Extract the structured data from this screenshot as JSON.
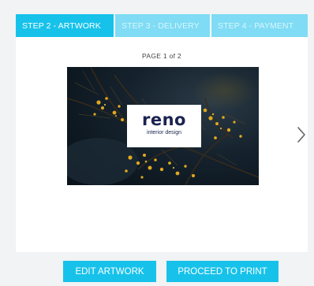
{
  "tabs": [
    {
      "label": "STEP 2 - ARTWORK",
      "active": true
    },
    {
      "label": "STEP 3 - DELIVERY",
      "active": false
    },
    {
      "label": "STEP 4 - PAYMENT",
      "active": false
    }
  ],
  "preview": {
    "page_indicator": "PAGE 1 of 2",
    "logo_word": "reno",
    "logo_sub": "interior design"
  },
  "actions": {
    "edit_label": "EDIT ARTWORK",
    "print_label": "PROCEED TO PRINT"
  },
  "icons": {
    "next": "chevron-right-icon"
  },
  "colors": {
    "accent": "#17c2ea",
    "tab_inactive": "#7fdcf4",
    "background": "#f1f3f4",
    "logo_text": "#1b2350"
  }
}
